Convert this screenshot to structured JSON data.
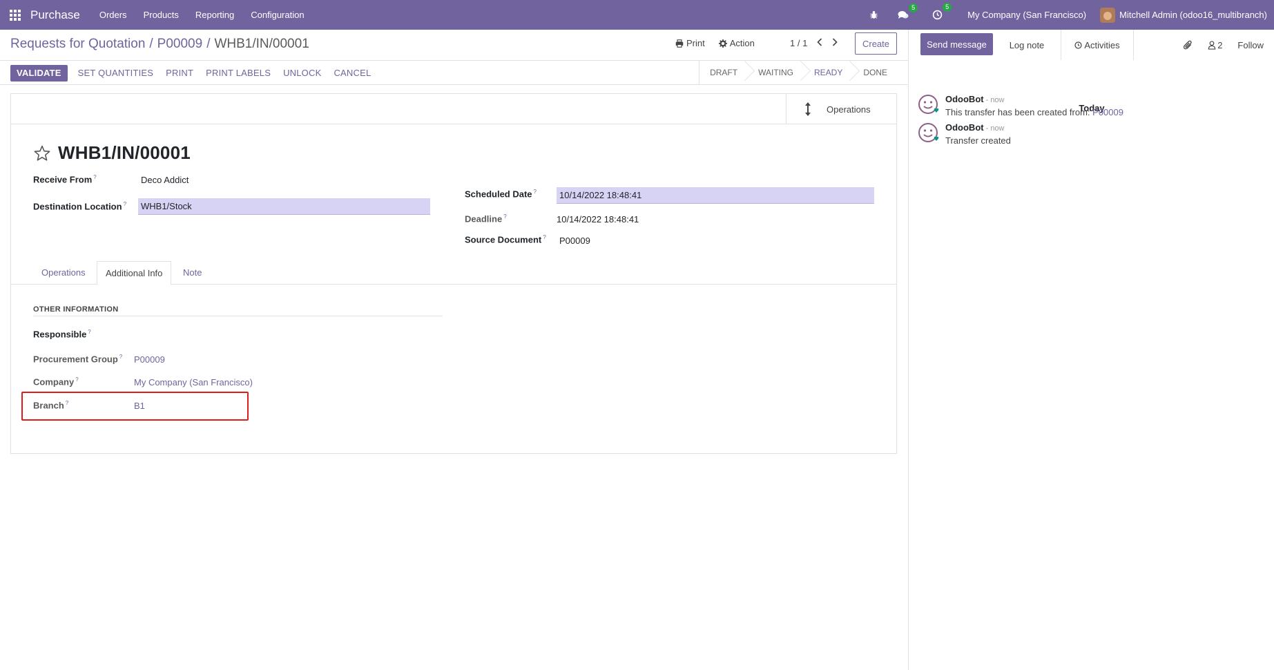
{
  "navbar": {
    "brand": "Purchase",
    "menu": [
      "Orders",
      "Products",
      "Reporting",
      "Configuration"
    ],
    "messages_badge": "5",
    "activities_badge": "5",
    "company": "My Company (San Francisco)",
    "user": "Mitchell Admin (odoo16_multibranch)"
  },
  "control_panel": {
    "breadcrumb": [
      "Requests for Quotation",
      "P00009",
      "WHB1/IN/00001"
    ],
    "print_label": "Print",
    "action_label": "Action",
    "pager": "1 / 1",
    "create_label": "Create"
  },
  "statusbar": {
    "buttons": [
      "VALIDATE",
      "SET QUANTITIES",
      "PRINT",
      "PRINT LABELS",
      "UNLOCK",
      "CANCEL"
    ],
    "stages": [
      "DRAFT",
      "WAITING",
      "READY",
      "DONE"
    ],
    "current_stage": "READY"
  },
  "form": {
    "smart_button_label": "Operations",
    "title": "WHB1/IN/00001",
    "receive_from_label": "Receive From",
    "receive_from": "Deco Addict",
    "destination_label": "Destination Location",
    "destination": "WHB1/Stock",
    "scheduled_date_label": "Scheduled Date",
    "scheduled_date": "10/14/2022 18:48:41",
    "deadline_label": "Deadline",
    "deadline": "10/14/2022 18:48:41",
    "source_document_label": "Source Document",
    "source_document": "P00009",
    "tabs": [
      "Operations",
      "Additional Info",
      "Note"
    ],
    "active_tab": "Additional Info",
    "section_title": "OTHER INFORMATION",
    "responsible_label": "Responsible",
    "responsible": "",
    "procurement_group_label": "Procurement Group",
    "procurement_group": "P00009",
    "company_label": "Company",
    "company": "My Company (San Francisco)",
    "branch_label": "Branch",
    "branch": "B1",
    "help_marker": "?"
  },
  "chatter": {
    "send_message": "Send message",
    "log_note": "Log note",
    "activities": "Activities",
    "followers_count": "2",
    "follow": "Follow",
    "date_separator": "Today",
    "messages": [
      {
        "author": "OdooBot",
        "time": "- now",
        "body": "This transfer has been created from: ",
        "link": "P00009"
      },
      {
        "author": "OdooBot",
        "time": "- now",
        "body": "Transfer created",
        "link": ""
      }
    ]
  },
  "colors": {
    "brand": "#71639e",
    "highlight_input": "#d6d3f5",
    "annotation_red": "#e01b1b",
    "badge_green": "#28a745"
  }
}
